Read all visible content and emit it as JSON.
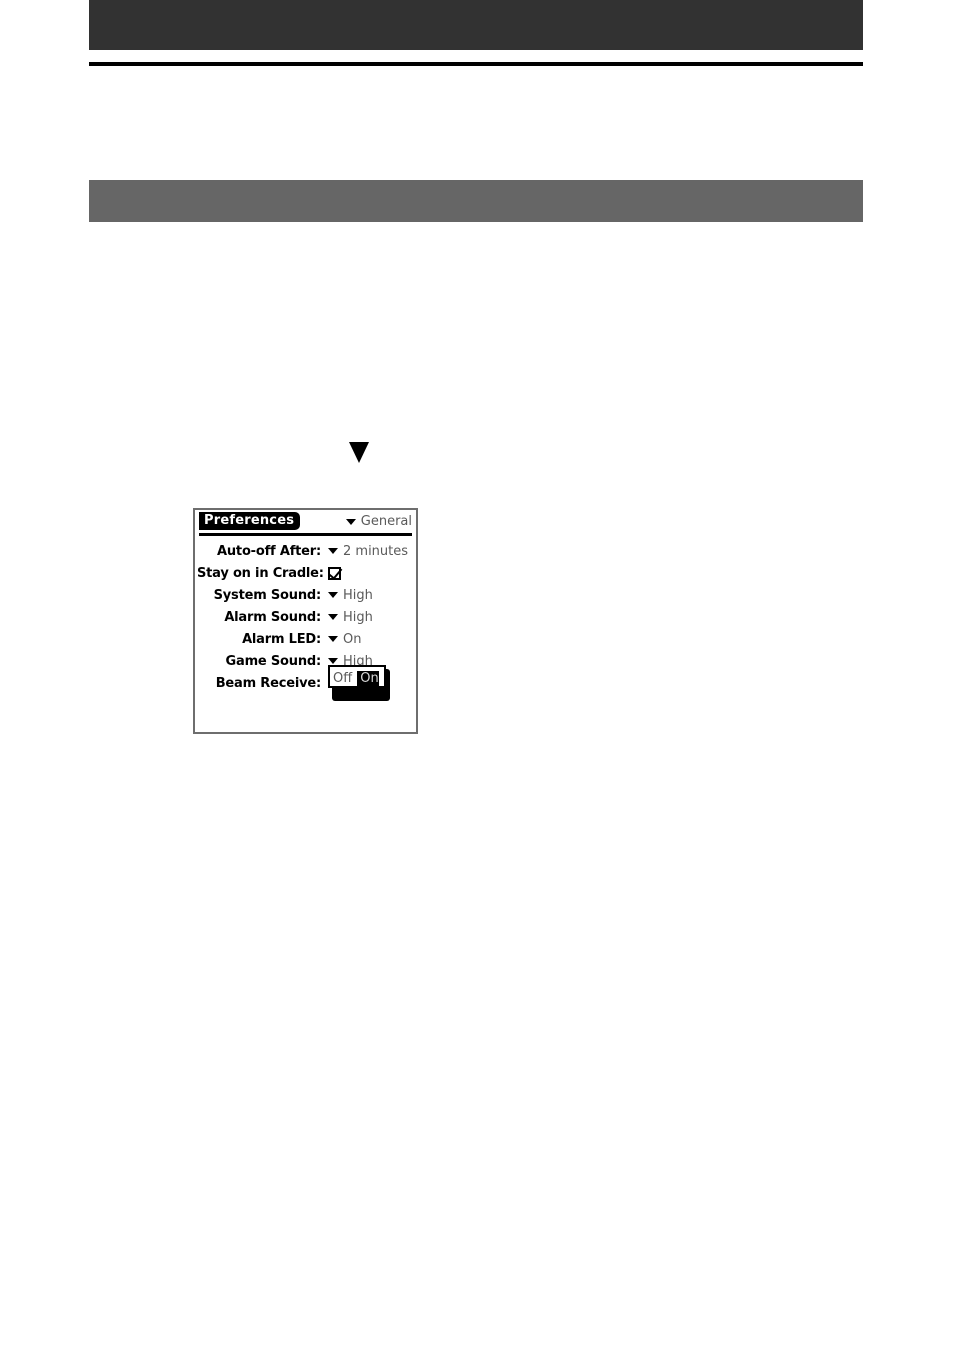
{
  "page": {
    "header_bar": {
      "text": "",
      "color": "#323232"
    },
    "section_bar": {
      "text": "",
      "color": "#666666"
    },
    "rule_color": "#000000"
  },
  "step_marker": {
    "icon": "triangle-down-icon"
  },
  "device": {
    "titlebar": {
      "title": "Preferences",
      "picker_icon": "triangle-down-icon",
      "picker_value": "General"
    },
    "rows": [
      {
        "label": "Auto-off After:",
        "control": "picker",
        "icon": "triangle-down-icon",
        "value": "2 minutes"
      },
      {
        "label": "Stay on in Cradle:",
        "control": "checkbox",
        "icon": "checkbox-checked-icon",
        "value": ""
      },
      {
        "label": "System Sound:",
        "control": "picker",
        "icon": "triangle-down-icon",
        "value": "High"
      },
      {
        "label": "Alarm Sound:",
        "control": "picker",
        "icon": "triangle-down-icon",
        "value": "High"
      },
      {
        "label": "Alarm LED:",
        "control": "picker",
        "icon": "triangle-down-icon",
        "value": "On"
      },
      {
        "label": "Game Sound:",
        "control": "picker",
        "icon": "triangle-down-icon",
        "value": "High"
      }
    ],
    "beam_receive": {
      "label": "Beam Receive:",
      "options": [
        {
          "label": "Off",
          "selected": false
        },
        {
          "label": "On",
          "selected": true
        }
      ]
    }
  }
}
